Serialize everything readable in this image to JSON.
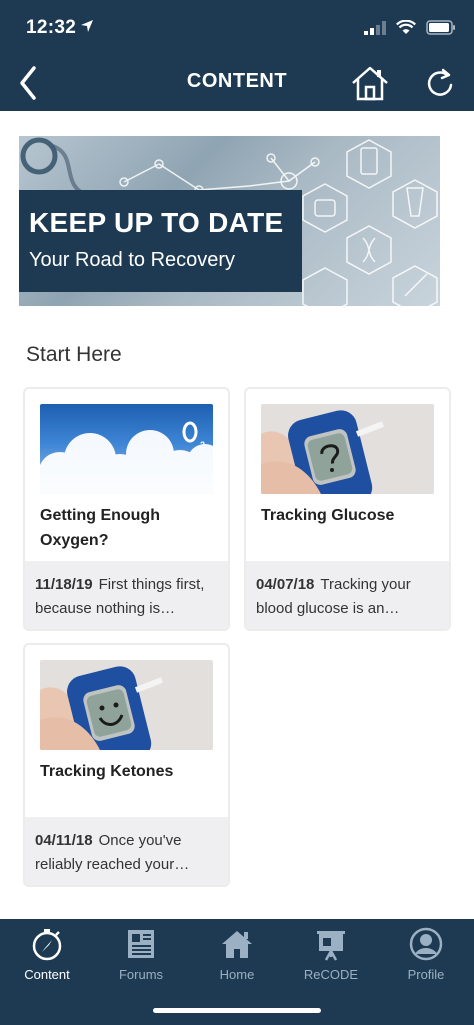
{
  "status": {
    "time": "12:32"
  },
  "header": {
    "title": "CONTENT"
  },
  "banner": {
    "title": "KEEP UP TO DATE",
    "subtitle": "Your Road to Recovery"
  },
  "section": {
    "title": "Start Here"
  },
  "cards": [
    {
      "title": "Getting Enough Oxygen?",
      "date": "11/18/19",
      "snippet": "First things first, because nothing is…",
      "image": "clouds-o2"
    },
    {
      "title": "Tracking Glucose",
      "date": "04/07/18",
      "snippet": "Tracking your blood glucose is an…",
      "image": "glucose-meter-question"
    },
    {
      "title": "Tracking Ketones",
      "date": "04/11/18",
      "snippet": "Once you've reliably reached your…",
      "image": "glucose-meter-smile"
    }
  ],
  "tabs": [
    {
      "label": "Content",
      "icon": "compass-icon",
      "active": true
    },
    {
      "label": "Forums",
      "icon": "newspaper-icon",
      "active": false
    },
    {
      "label": "Home",
      "icon": "home-icon",
      "active": false
    },
    {
      "label": "ReCODE",
      "icon": "presentation-icon",
      "active": false
    },
    {
      "label": "Profile",
      "icon": "profile-icon",
      "active": false
    }
  ],
  "colors": {
    "navy": "#1d3a52",
    "tab_inactive": "#9bb0c2",
    "card_footer": "#efeff1"
  }
}
